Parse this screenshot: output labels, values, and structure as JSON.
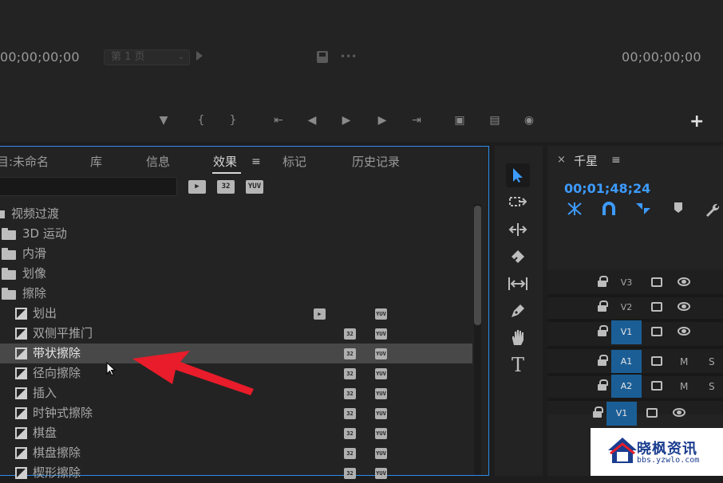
{
  "monitor": {
    "timecode_left": "00;00;00;00",
    "page_select": "第 1 页",
    "timecode_right": "00;00;00;00",
    "transport_icons": [
      "marker-icon",
      "mark-in-icon",
      "mark-out-icon",
      "go-to-in-icon",
      "step-back-icon",
      "play-icon",
      "step-forward-icon",
      "go-to-out-icon",
      "insert-icon",
      "overwrite-icon",
      "export-frame-icon",
      "add-button-icon"
    ]
  },
  "effects_panel": {
    "tabs": [
      {
        "id": "project",
        "label": "目:未命名"
      },
      {
        "id": "library",
        "label": "库"
      },
      {
        "id": "info",
        "label": "信息"
      },
      {
        "id": "effects",
        "label": "效果"
      },
      {
        "id": "markers",
        "label": "标记"
      },
      {
        "id": "history",
        "label": "历史记录"
      }
    ],
    "active_tab": "效果",
    "search_value": "",
    "filter_icons": [
      "accelerated-filter-icon",
      "32-bit-filter-icon",
      "yuv-filter-icon"
    ],
    "filter_labels": [
      "",
      "32",
      "YUV"
    ],
    "tree": [
      {
        "label": "视频过渡",
        "kind": "bin",
        "level": 0
      },
      {
        "label": "3D 运动",
        "kind": "folder",
        "level": 1
      },
      {
        "label": "内滑",
        "kind": "folder",
        "level": 1
      },
      {
        "label": "划像",
        "kind": "folder",
        "level": 1
      },
      {
        "label": "擦除",
        "kind": "folder",
        "level": 1
      },
      {
        "label": "划出",
        "kind": "effect",
        "level": 2,
        "badges": [
          "accel",
          "yuv"
        ]
      },
      {
        "label": "双侧平推门",
        "kind": "effect",
        "level": 2,
        "badges": [
          "32",
          "yuv"
        ]
      },
      {
        "label": "带状擦除",
        "kind": "effect",
        "level": 2,
        "badges": [
          "32",
          "yuv"
        ],
        "selected": true
      },
      {
        "label": "径向擦除",
        "kind": "effect",
        "level": 2,
        "badges": [
          "32",
          "yuv"
        ]
      },
      {
        "label": "插入",
        "kind": "effect",
        "level": 2,
        "badges": [
          "32",
          "yuv"
        ]
      },
      {
        "label": "时钟式擦除",
        "kind": "effect",
        "level": 2,
        "badges": [
          "32",
          "yuv"
        ]
      },
      {
        "label": "棋盘",
        "kind": "effect",
        "level": 2,
        "badges": [
          "32",
          "yuv"
        ]
      },
      {
        "label": "棋盘擦除",
        "kind": "effect",
        "level": 2,
        "badges": [
          "32",
          "yuv"
        ]
      },
      {
        "label": "楔形擦除",
        "kind": "effect",
        "level": 2,
        "badges": [
          "32",
          "yuv"
        ]
      }
    ]
  },
  "tools": [
    "selection-tool-icon",
    "track-select-icon",
    "ripple-edit-icon",
    "razor-icon",
    "slip-icon",
    "pen-icon",
    "hand-icon",
    "type-icon"
  ],
  "timeline": {
    "sequence_name": "千星",
    "timecode": "00;01;48;24",
    "tracks": [
      {
        "name": "V3",
        "active": false,
        "type": "video"
      },
      {
        "name": "V2",
        "active": false,
        "type": "video"
      },
      {
        "name": "V1",
        "active": true,
        "type": "video"
      },
      {
        "name": "A1",
        "active": true,
        "type": "audio",
        "m": "M",
        "s": "S"
      },
      {
        "name": "A2",
        "active": true,
        "type": "audio",
        "m": "M",
        "s": "S"
      },
      {
        "name": "V1",
        "active": true,
        "type": "video"
      }
    ]
  },
  "watermark": {
    "title": "晓枫资讯",
    "url": "bbs.yzwlo.com"
  },
  "colors": {
    "accent_blue": "#2d8ceb",
    "timecode_blue": "#3d9bff",
    "track_active": "#1b5e96",
    "arrow_red": "#e81c2a"
  }
}
